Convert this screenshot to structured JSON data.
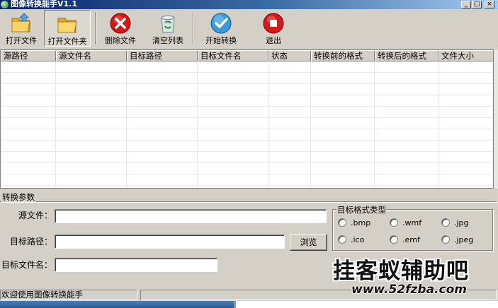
{
  "window": {
    "title": "图像转换能手V1.1"
  },
  "toolbar": {
    "open_file": "打开文件",
    "open_folder": "打开文件夹",
    "delete_file": "删除文件",
    "clear_list": "清空列表",
    "start_convert": "开始转换",
    "exit": "退出"
  },
  "table": {
    "columns": [
      "源路径",
      "源文件名",
      "目标路径",
      "目标文件名",
      "状态",
      "转换前的格式",
      "转换后的格式",
      "文件大小"
    ]
  },
  "params": {
    "group_label": "转换参数",
    "source_file_label": "源文件：",
    "target_path_label": "目标路径：",
    "target_name_label": "目标文件名：",
    "source_file_value": "",
    "target_path_value": "",
    "target_name_value": "",
    "browse_button": "浏览"
  },
  "format": {
    "group_label": "目标格式类型",
    "options": [
      ".bmp",
      ".wmf",
      ".jpg",
      ".ico",
      ".emf",
      ".jpeg"
    ]
  },
  "status": {
    "message": "欢迎使用图像转换能手"
  },
  "watermark": {
    "brand": "挂客蚁辅助吧",
    "url": "www.52fzba.com"
  },
  "colors": {
    "titlebar_start": "#0a246a",
    "titlebar_end": "#a6caf0",
    "face": "#d4d0c8"
  }
}
